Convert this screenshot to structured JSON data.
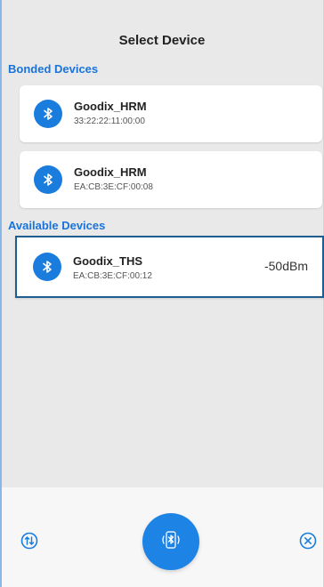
{
  "page": {
    "title": "Select Device"
  },
  "sections": {
    "bonded": "Bonded Devices",
    "available": "Available Devices"
  },
  "bonded_devices": [
    {
      "name": "Goodix_HRM",
      "address": "33:22:22:11:00:00"
    },
    {
      "name": "Goodix_HRM",
      "address": "EA:CB:3E:CF:00:08"
    }
  ],
  "available_devices": [
    {
      "name": "Goodix_THS",
      "address": "EA:CB:3E:CF:00:12",
      "rssi": "-50dBm"
    }
  ],
  "icons": {
    "device": "bluetooth-icon",
    "sort": "sort-icon",
    "scan": "bluetooth-scan-icon",
    "close": "close-icon"
  },
  "colors": {
    "accent": "#1a7cdc",
    "selected_border": "#1e5f93"
  }
}
